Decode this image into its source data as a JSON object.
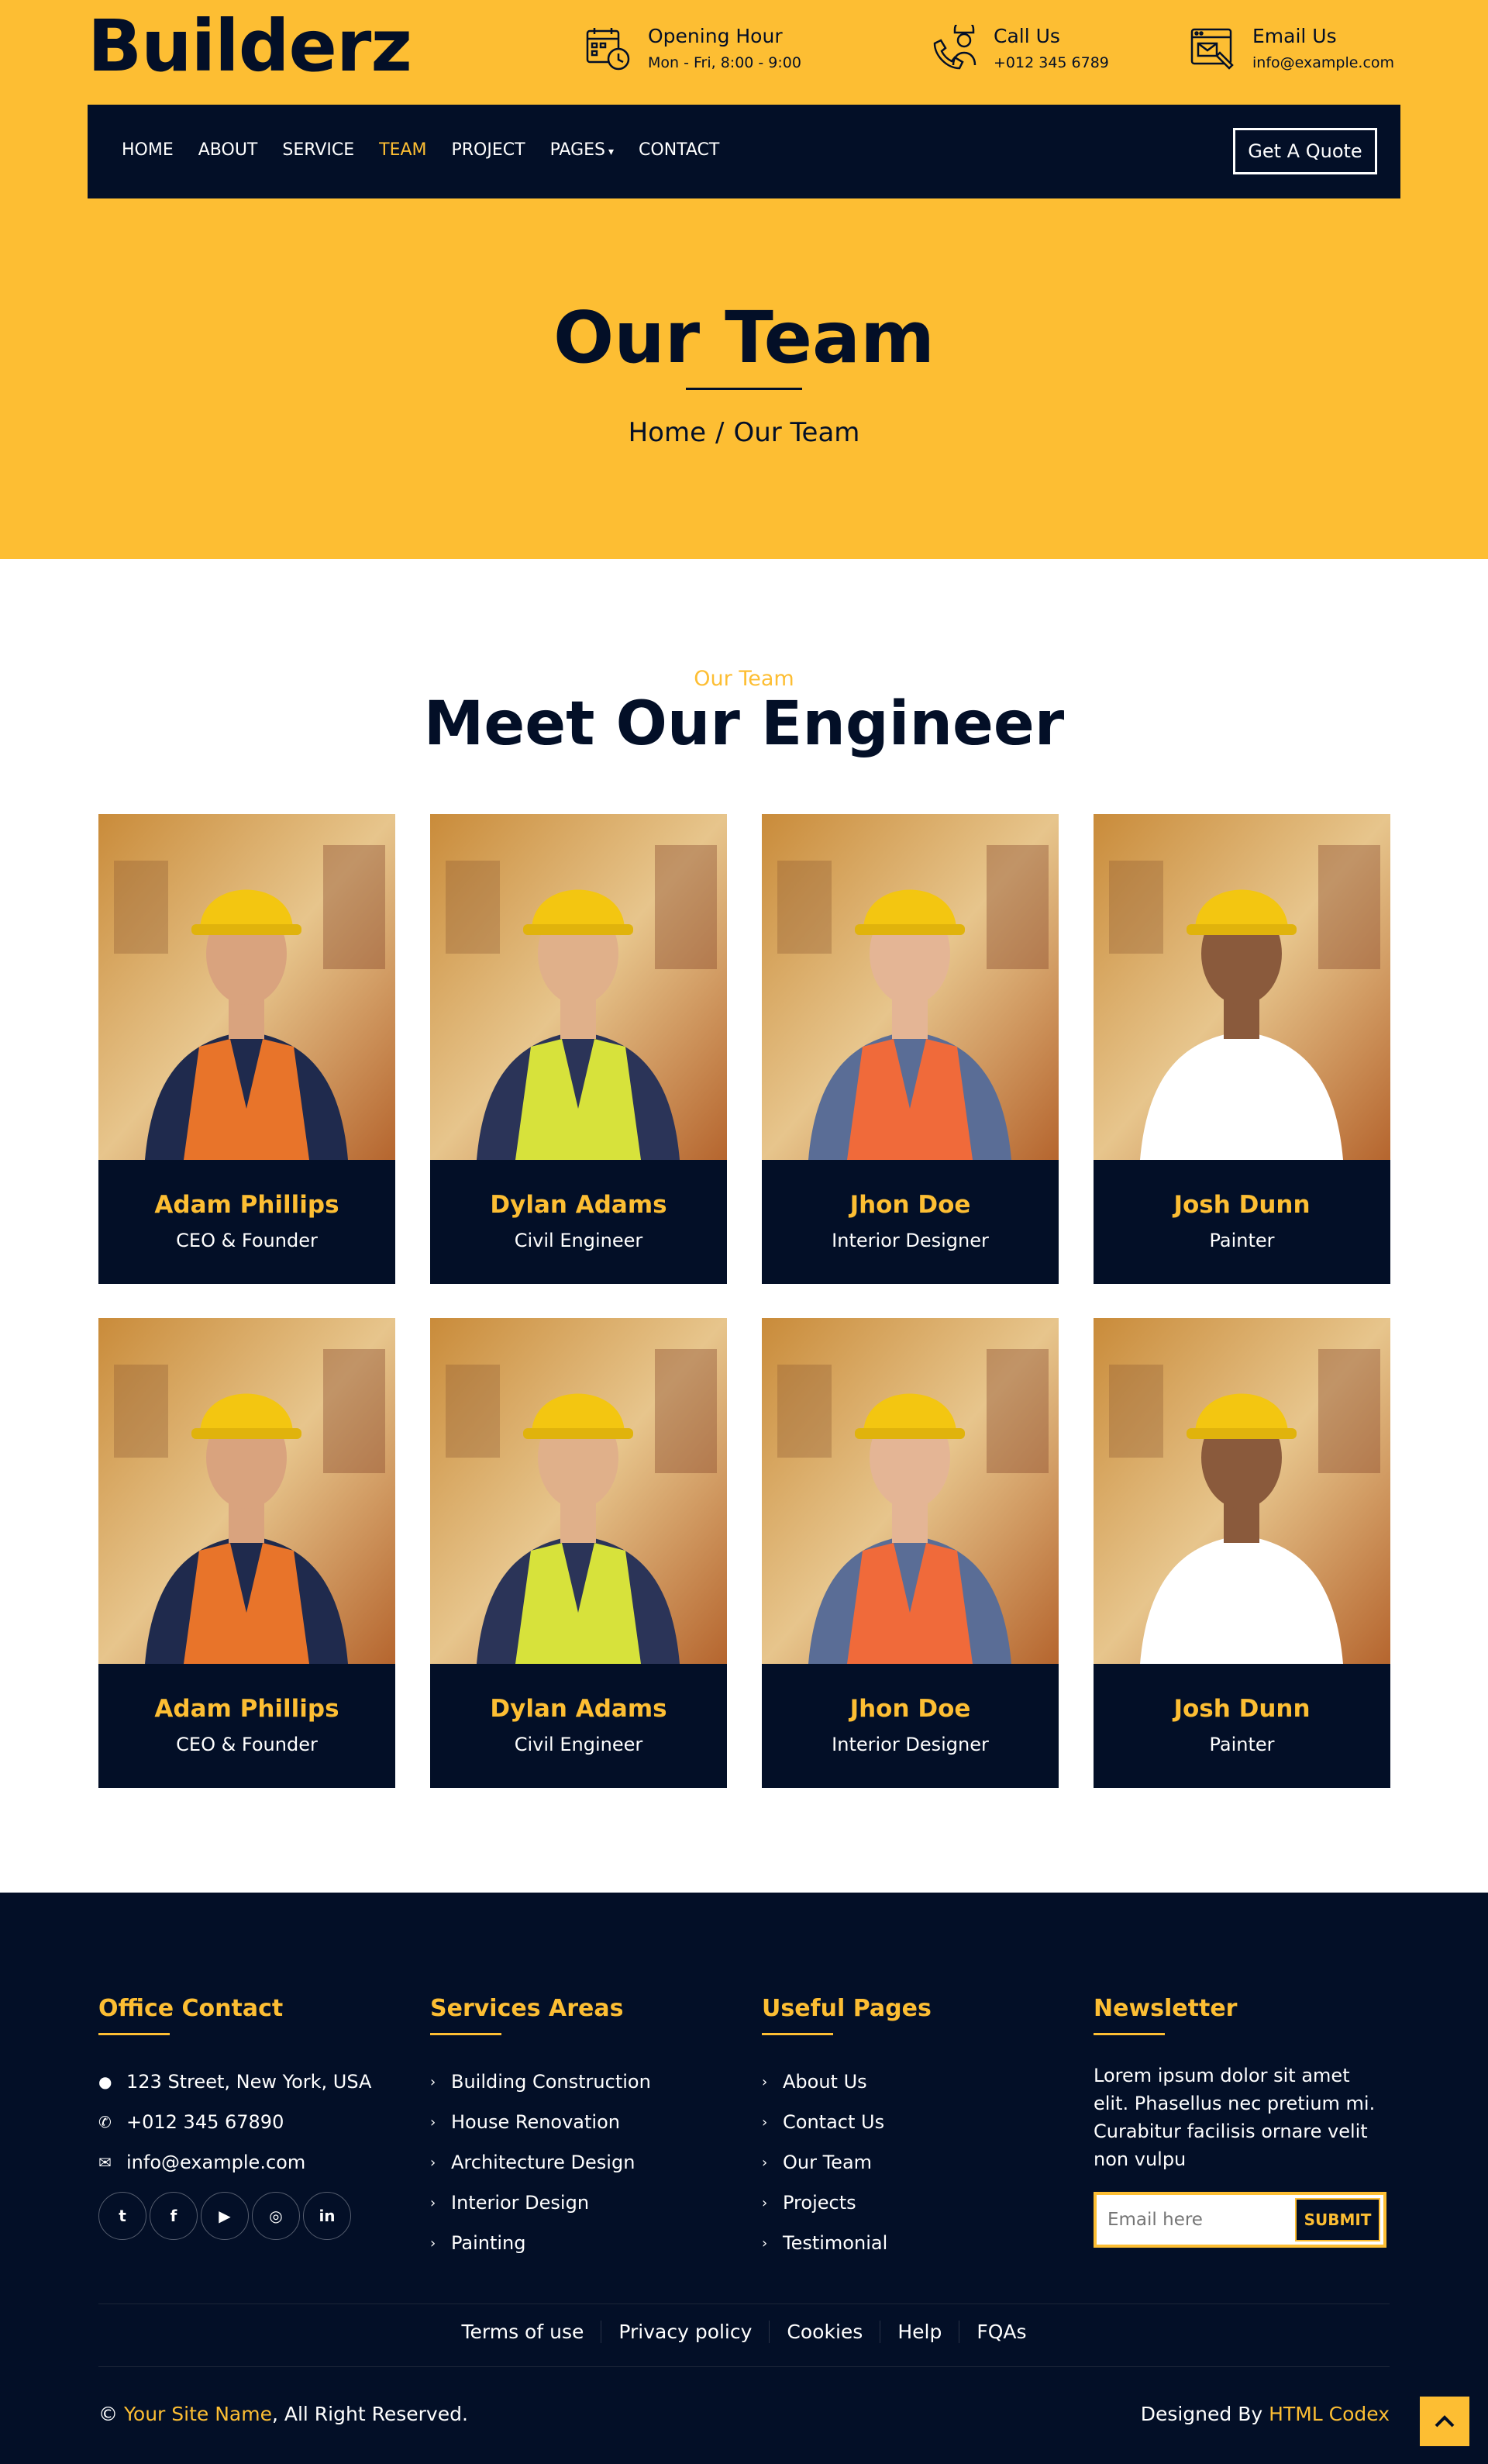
{
  "brand": {
    "logo": "Builderz"
  },
  "contact_info": [
    {
      "icon": "calendar-clock-icon",
      "title": "Opening Hour",
      "value": "Mon - Fri, 8:00 - 9:00"
    },
    {
      "icon": "phone-worker-icon",
      "title": "Call Us",
      "value": "+012 345 6789"
    },
    {
      "icon": "email-window-icon",
      "title": "Email Us",
      "value": "info@example.com"
    }
  ],
  "nav": {
    "items": [
      {
        "label": "HOME",
        "active": false
      },
      {
        "label": "ABOUT",
        "active": false
      },
      {
        "label": "SERVICE",
        "active": false
      },
      {
        "label": "TEAM",
        "active": true
      },
      {
        "label": "PROJECT",
        "active": false
      },
      {
        "label": "PAGES",
        "active": false,
        "dropdown": true
      },
      {
        "label": "CONTACT",
        "active": false
      }
    ],
    "quote_button": "Get A Quote"
  },
  "hero": {
    "title": "Our Team",
    "breadcrumb": [
      "Home",
      "/",
      "Our Team"
    ]
  },
  "team_section": {
    "subtitle": "Our Team",
    "title": "Meet Our Engineer",
    "members": [
      {
        "name": "Adam Phillips",
        "role": "CEO & Founder"
      },
      {
        "name": "Dylan Adams",
        "role": "Civil Engineer"
      },
      {
        "name": "Jhon Doe",
        "role": "Interior Designer"
      },
      {
        "name": "Josh Dunn",
        "role": "Painter"
      },
      {
        "name": "Adam Phillips",
        "role": "CEO & Founder"
      },
      {
        "name": "Dylan Adams",
        "role": "Civil Engineer"
      },
      {
        "name": "Jhon Doe",
        "role": "Interior Designer"
      },
      {
        "name": "Josh Dunn",
        "role": "Painter"
      }
    ]
  },
  "footer": {
    "office": {
      "title": "Office Contact",
      "address": "123 Street, New York, USA",
      "phone": "+012 345 67890",
      "email": "info@example.com",
      "socials": [
        "twitter-icon",
        "facebook-icon",
        "youtube-icon",
        "instagram-icon",
        "linkedin-icon"
      ]
    },
    "services": {
      "title": "Services Areas",
      "items": [
        "Building Construction",
        "House Renovation",
        "Architecture Design",
        "Interior Design",
        "Painting"
      ]
    },
    "pages": {
      "title": "Useful Pages",
      "items": [
        "About Us",
        "Contact Us",
        "Our Team",
        "Projects",
        "Testimonial"
      ]
    },
    "newsletter": {
      "title": "Newsletter",
      "text": "Lorem ipsum dolor sit amet elit. Phasellus nec pretium mi. Curabitur facilisis ornare velit non vulpu",
      "placeholder": "Email here",
      "submit": "SUBMIT"
    },
    "bottom_links": [
      "Terms of use",
      "Privacy policy",
      "Cookies",
      "Help",
      "FQAs"
    ],
    "copyright_prefix": "©",
    "site_name": "Your Site Name",
    "copyright_suffix": ", All Right Reserved.",
    "designed_by": "Designed By",
    "designer": "HTML Codex"
  },
  "colors": {
    "accent": "#fdbe33",
    "dark": "#030f27",
    "white": "#ffffff"
  }
}
